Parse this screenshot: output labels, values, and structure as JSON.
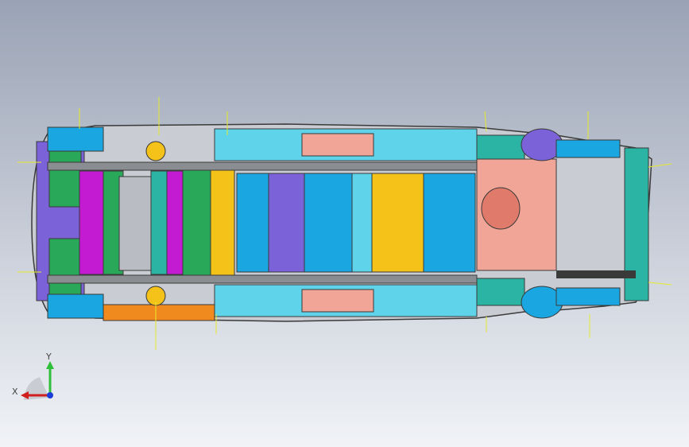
{
  "viewport": {
    "background_top": "#9aa3b5",
    "background_bottom": "#f1f3f7"
  },
  "model": {
    "name_icon": "car-underbody-assembly-icon",
    "colors": {
      "outline": "#3a3a3a",
      "cyan": "#1aa6e0",
      "light_cyan": "#5fd3ea",
      "teal": "#2bb3a3",
      "green": "#29a85a",
      "magenta": "#c21bd1",
      "purple": "#7b62d8",
      "orange": "#f08a1e",
      "yellow": "#f5c21a",
      "salmon": "#f0a596",
      "gray": "#b9bcc2",
      "annotation_line": "#e7ea2a"
    }
  },
  "triad": {
    "x_label": "X",
    "y_label": "Y",
    "x_color": "#d11f1f",
    "y_color": "#2fbf3b",
    "z_color": "#1b3cd8"
  }
}
